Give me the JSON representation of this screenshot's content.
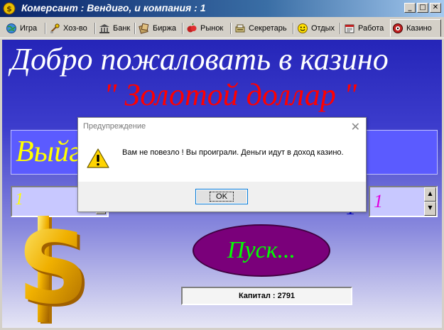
{
  "window": {
    "title": "Комерсант : Вендиго, и компания : 1",
    "controls": [
      "_",
      "□",
      "✕"
    ]
  },
  "tabs": [
    {
      "label": "Игра",
      "icon": "globe-icon"
    },
    {
      "label": "Хоз-во",
      "icon": "tools-icon"
    },
    {
      "label": "Банк",
      "icon": "bank-icon"
    },
    {
      "label": "Биржа",
      "icon": "exchange-icon"
    },
    {
      "label": "Рынок",
      "icon": "market-icon"
    },
    {
      "label": "Секретарь",
      "icon": "secretary-icon"
    },
    {
      "label": "Отдых",
      "icon": "smiley-icon"
    },
    {
      "label": "Работа",
      "icon": "work-icon"
    },
    {
      "label": "Казино",
      "icon": "casino-icon",
      "active": true
    }
  ],
  "casino": {
    "welcome": "Добро пожаловать в казино",
    "name": "\" Золотой доллар \"",
    "info_text": "Выйг",
    "left_number": "1",
    "right_prefix": "1",
    "right_number": "1",
    "start_label": "Пуск...",
    "capital_label": "Капитал : 2791"
  },
  "dialog": {
    "title": "Предупреждение",
    "message": "Вам не повезло ! Вы проиграли. Деньги идут в доход казино.",
    "ok_label": "OK",
    "icon": "warning-icon"
  },
  "colors": {
    "title_bar": "#0a246a",
    "panel_top": "#2525b8",
    "welcome_text": "#ffffff",
    "casino_name": "#ff0000",
    "info_text": "#ffff00",
    "start_button": "#7a007a",
    "start_text": "#00ff00"
  }
}
